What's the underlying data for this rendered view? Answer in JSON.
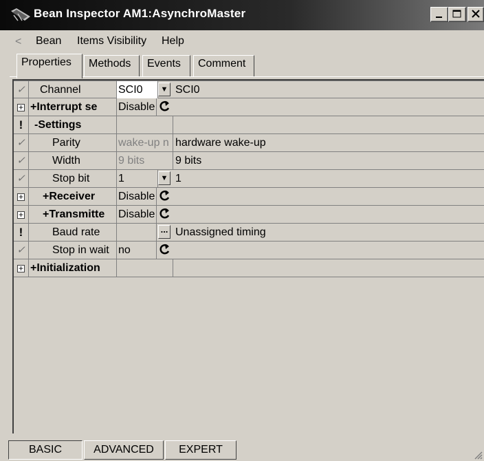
{
  "window": {
    "title": "Bean Inspector AM1:AsynchroMaster"
  },
  "menu": {
    "items": [
      "Bean",
      "Items Visibility",
      "Help"
    ]
  },
  "tabs": [
    "Properties",
    "Methods",
    "Events",
    "Comment"
  ],
  "rows": [
    {
      "icon": "check",
      "name": "Channel",
      "value": "SCI0",
      "detail": "SCI0",
      "control": "dropdown"
    },
    {
      "icon": "expand",
      "name": "+Interrupt se",
      "value": "Disable",
      "detail": "",
      "control": "toggle"
    },
    {
      "icon": "warning",
      "name": "-Settings",
      "value": "",
      "detail": "",
      "control": ""
    },
    {
      "icon": "check",
      "name": "Parity",
      "value": "wake-up n",
      "detail": "hardware wake-up",
      "control": ""
    },
    {
      "icon": "check",
      "name": "Width",
      "value": "9 bits",
      "detail": "9 bits",
      "control": ""
    },
    {
      "icon": "check",
      "name": "Stop bit",
      "value": "1",
      "detail": "1",
      "control": "dropdown"
    },
    {
      "icon": "expand",
      "name": "+Receiver",
      "value": "Disable",
      "detail": "",
      "control": "toggle"
    },
    {
      "icon": "expand",
      "name": "+Transmitte",
      "value": "Disable",
      "detail": "",
      "control": "toggle"
    },
    {
      "icon": "warning",
      "name": "Baud rate",
      "value": "",
      "detail": "Unassigned timing",
      "control": "dialog"
    },
    {
      "icon": "check",
      "name": "Stop in wait",
      "value": "no",
      "detail": "",
      "control": "toggle"
    },
    {
      "icon": "expand",
      "name": "+Initialization",
      "value": "",
      "detail": "",
      "control": ""
    }
  ],
  "bottom_buttons": [
    "BASIC",
    "ADVANCED",
    "EXPERT"
  ],
  "colors": {
    "title_bar": "#0a0a0a",
    "face": "#d4d0c8"
  }
}
